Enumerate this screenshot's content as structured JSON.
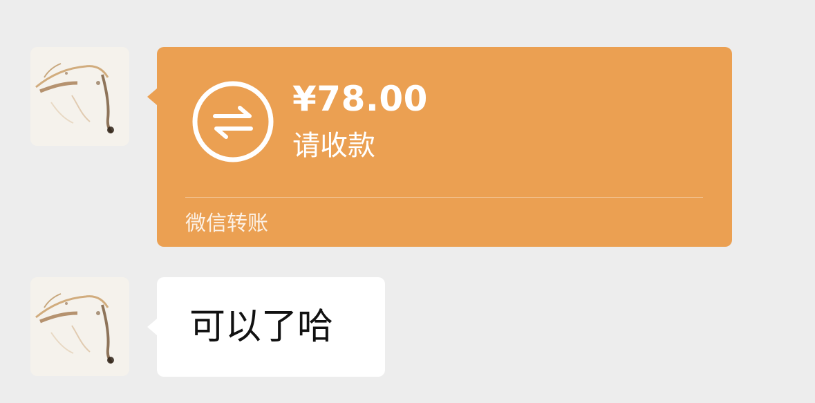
{
  "messages": [
    {
      "type": "transfer",
      "sender_avatar": "avatar",
      "icon": "transfer-arrows-icon",
      "amount": "¥78.00",
      "status": "请收款",
      "footer": "微信转账",
      "bubble_color": "#eba052"
    },
    {
      "type": "text",
      "sender_avatar": "avatar",
      "text": "可以了哈",
      "bubble_color": "#ffffff"
    }
  ],
  "colors": {
    "background": "#ededed",
    "transfer_bubble": "#eba052",
    "text_bubble": "#ffffff",
    "text_primary": "#111111"
  }
}
